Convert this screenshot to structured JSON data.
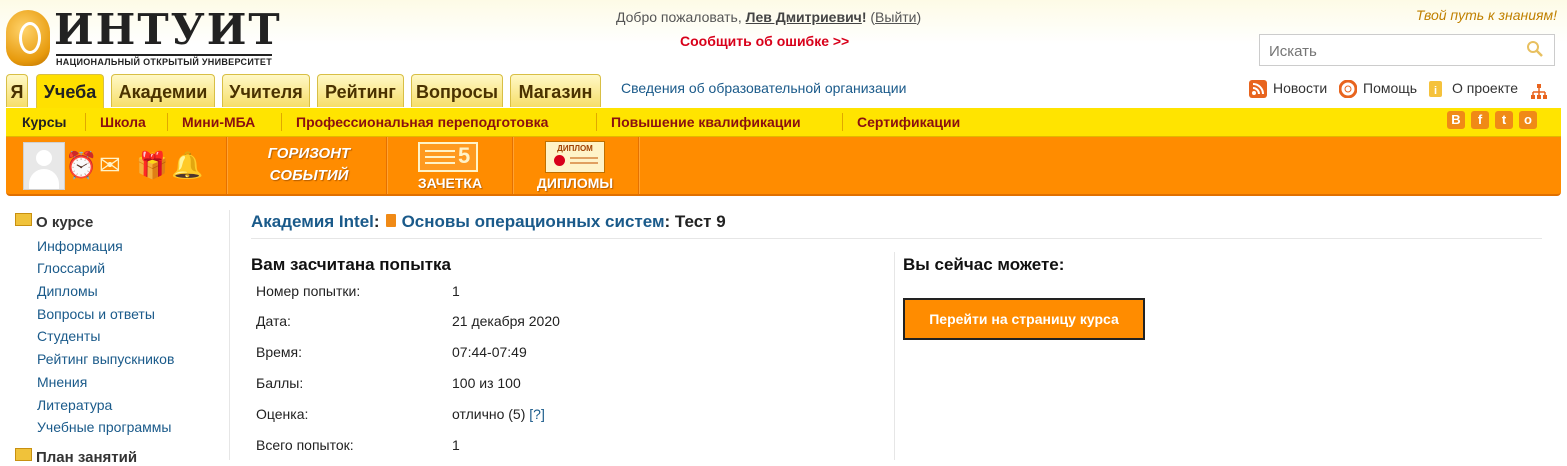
{
  "logo": {
    "title": "ИНТУИТ",
    "subtitle": "НАЦИОНАЛЬНЫЙ ОТКРЫТЫЙ УНИВЕРСИТЕТ"
  },
  "header": {
    "welcome_prefix": "Добро пожаловать,",
    "user_name": "Лев Дмитриевич",
    "welcome_excl": "!",
    "logout_open": "(",
    "logout_label": "Выйти",
    "logout_close": ")",
    "report_error": "Сообщить об ошибке >>",
    "slogan": "Твой путь к знаниям!",
    "search_placeholder": "Искать"
  },
  "tabs": [
    {
      "label": "Я"
    },
    {
      "label": "Учеба",
      "active": true
    },
    {
      "label": "Академии"
    },
    {
      "label": "Учителя"
    },
    {
      "label": "Рейтинг"
    },
    {
      "label": "Вопросы"
    },
    {
      "label": "Магазин"
    }
  ],
  "org_info_link": "Сведения об образовательной организации",
  "top_links": {
    "news": "Новости",
    "help": "Помощь",
    "about": "О проекте"
  },
  "subnav": [
    {
      "label": "Курсы",
      "active": true
    },
    {
      "label": "Школа"
    },
    {
      "label": "Мини-МБА"
    },
    {
      "label": "Профессиональная переподготовка"
    },
    {
      "label": "Повышение квалификации"
    },
    {
      "label": "Сертификации"
    }
  ],
  "social": [
    "В",
    "f",
    "t",
    "о"
  ],
  "toolbar": {
    "horizon_line1": "ГОРИЗОНТ",
    "horizon_line2": "СОБЫТИЙ",
    "grade_digit": "5",
    "record_book": "ЗАЧЕТКА",
    "diploma_small": "ДИПЛОМ",
    "diplomas": "ДИПЛОМЫ"
  },
  "sidebar": {
    "about_header": "О курсе",
    "about_items": [
      "Информация",
      "Глоссарий",
      "Дипломы",
      "Вопросы и ответы",
      "Студенты",
      "Рейтинг выпускников",
      "Мнения",
      "Литература",
      "Учебные программы"
    ],
    "plan_header": "План занятий"
  },
  "breadcrumb": {
    "academy": "Академия Intel",
    "sep": ":",
    "course": "Основы операционных систем",
    "test": ": Тест 9"
  },
  "attempt": {
    "heading": "Вам засчитана попытка",
    "rows": [
      {
        "label": "Номер попытки:",
        "value": "1"
      },
      {
        "label": "Дата:",
        "value": "21 декабря 2020"
      },
      {
        "label": "Время:",
        "value": "07:44-07:49"
      },
      {
        "label": "Баллы:",
        "value": "100 из 100"
      },
      {
        "label": "Оценка:",
        "value": "отлично (5)",
        "help": "[?]"
      },
      {
        "label": "Всего попыток:",
        "value": "1"
      }
    ]
  },
  "actions": {
    "heading": "Вы сейчас можете:",
    "go_to_course": "Перейти на страницу курса"
  },
  "colors": {
    "orange": "#ff8c00",
    "yellow": "#ffe400",
    "link": "#1a5a8a",
    "error_red": "#d8001a"
  }
}
